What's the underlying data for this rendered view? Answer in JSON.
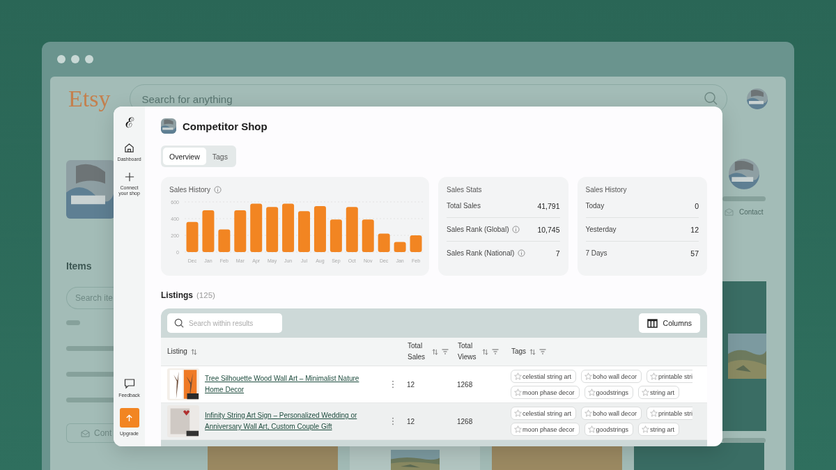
{
  "browser": {
    "logo": "Etsy",
    "search_placeholder": "Search for anything",
    "items_heading": "Items",
    "items_search_placeholder": "Search ite",
    "contact_button": "Cont",
    "shop_contact": "Contact"
  },
  "sidebar": {
    "logo": "ℰ",
    "items": [
      {
        "label": "Dashboard",
        "kind": "home"
      },
      {
        "label": "Connect your shop",
        "kind": "plus"
      }
    ],
    "bottom_items": [
      {
        "label": "Feedback",
        "kind": "chat"
      },
      {
        "label": "Upgrade",
        "kind": "upgrade"
      }
    ]
  },
  "shop": {
    "name": "Competitor Shop"
  },
  "tabs": [
    {
      "label": "Overview",
      "selected": true
    },
    {
      "label": "Tags",
      "selected": false
    }
  ],
  "sales_chart": {
    "title": "Sales History",
    "chart_data": {
      "type": "bar",
      "categories": [
        "Dec",
        "Jan",
        "Feb",
        "Mar",
        "Apr",
        "May",
        "Jun",
        "Jul",
        "Aug",
        "Sep",
        "Oct",
        "Nov",
        "Dec",
        "Jan",
        "Feb"
      ],
      "series": [
        {
          "color": "#f28522",
          "values": [
            360,
            500,
            270,
            500,
            580,
            540,
            580,
            490,
            550,
            390,
            540,
            390,
            220,
            120,
            200
          ]
        }
      ],
      "ylim": [
        0,
        600
      ],
      "yticks": [
        0,
        200,
        400,
        600
      ]
    }
  },
  "sales_stats": {
    "title": "Sales Stats",
    "rows": [
      {
        "label": "Total Sales",
        "value": "41,791",
        "info": false
      },
      {
        "label": "Sales Rank (Global)",
        "value": "10,745",
        "info": true
      },
      {
        "label": "Sales Rank (National)",
        "value": "7",
        "info": true
      }
    ]
  },
  "sales_history": {
    "title": "Sales History",
    "rows": [
      {
        "label": "Today",
        "value": "0",
        "info": false
      },
      {
        "label": "Yesterday",
        "value": "12",
        "info": false
      },
      {
        "label": "7 Days",
        "value": "57",
        "info": false
      }
    ]
  },
  "listings": {
    "title": "Listings",
    "count": "(125)",
    "search_placeholder": "Search within results",
    "columns_button": "Columns",
    "columns": [
      {
        "label": "Listing",
        "filter": false
      },
      {
        "label": "Total Sales",
        "filter": true
      },
      {
        "label": "Total Views",
        "filter": true
      },
      {
        "label": "Tags",
        "filter": true
      }
    ],
    "rows": [
      {
        "title": "Tree Silhouette Wood Wall Art – Minimalist Nature Home Decor",
        "sales": "12",
        "views": "1268",
        "selected": false,
        "tags": [
          [
            {
              "label": "celestial string art",
              "cut": false
            },
            {
              "label": "boho wall decor",
              "cut": false
            },
            {
              "label": "printable stri",
              "cut": true
            }
          ],
          [
            {
              "label": "moon phase decor",
              "cut": false
            },
            {
              "label": "goodstrings",
              "cut": false
            },
            {
              "label": "string art",
              "cut": false
            }
          ]
        ]
      },
      {
        "title": "Infinity String Art Sign – Personalized Wedding or Anniversary Wall Art, Custom Couple Gift",
        "sales": "12",
        "views": "1268",
        "selected": true,
        "tags": [
          [
            {
              "label": "celestial string art",
              "cut": false
            },
            {
              "label": "boho wall decor",
              "cut": false
            },
            {
              "label": "printable stri",
              "cut": true
            }
          ],
          [
            {
              "label": "moon phase decor",
              "cut": false
            },
            {
              "label": "goodstrings",
              "cut": false
            },
            {
              "label": "string art",
              "cut": false
            }
          ]
        ]
      }
    ]
  }
}
